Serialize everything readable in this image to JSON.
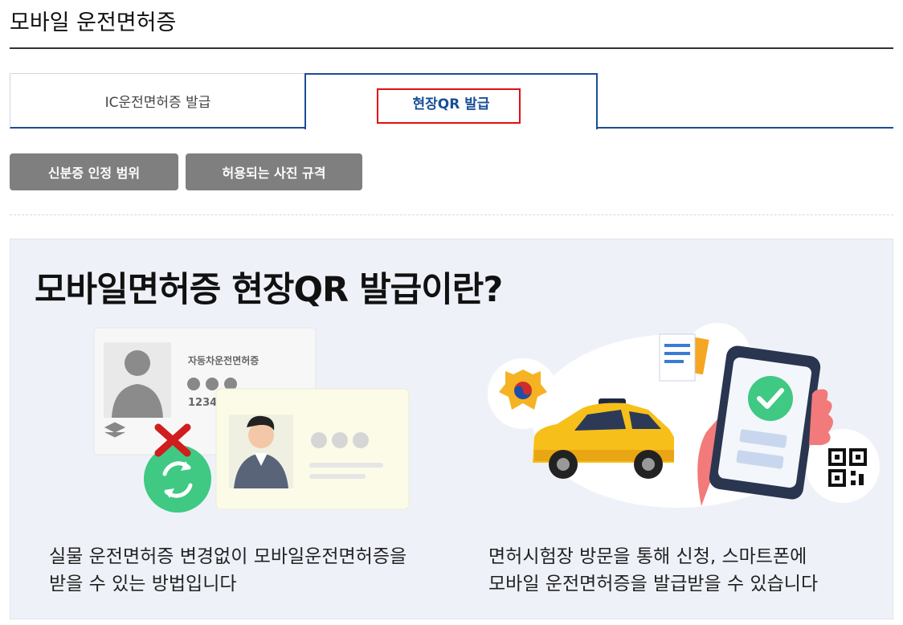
{
  "page": {
    "title": "모바일 운전면허증"
  },
  "tabs": [
    {
      "label": "IC운전면허증 발급",
      "active": false
    },
    {
      "label": "현장QR 발급",
      "active": true
    }
  ],
  "buttons": {
    "id_scope": "신분증 인정 범위",
    "photo_spec": "허용되는 사진 규격"
  },
  "section": {
    "heading": "모바일면허증 현장QR 발급이란?",
    "left_card": {
      "card_title": "자동차운전면허증",
      "card_number_partial": "12345"
    },
    "captions": {
      "left_line1": "실물 운전면허증 변경없이 모바일운전면허증을",
      "left_line2": "받을 수 있는 방법입니다",
      "right_line1": "면허시험장 방문을 통해 신청, 스마트폰에",
      "right_line2": "모바일 운전면허증을 발급받을 수 있습니다"
    }
  },
  "colors": {
    "accent_blue": "#1a4e96",
    "highlight_red": "#e01010",
    "button_gray": "#7f7f7f",
    "panel_bg": "#eef2f8",
    "green": "#34c76e",
    "taxi_yellow": "#f7bf1a"
  },
  "icons": [
    "close-x-icon",
    "refresh-icon",
    "check-icon",
    "qr-code-icon",
    "document-icon",
    "emblem-icon",
    "taxi-icon",
    "smartphone-icon"
  ]
}
